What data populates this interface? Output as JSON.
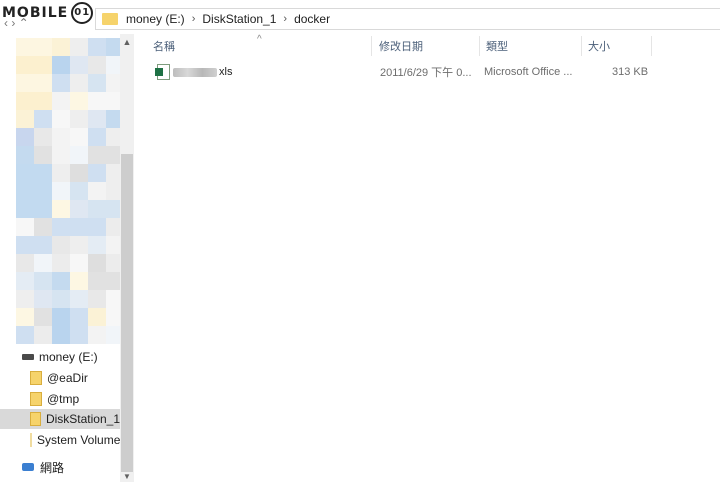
{
  "watermark": {
    "text": "MOBILE",
    "badge": "01"
  },
  "nav_arrows": "‹   ›   ⌃",
  "address": {
    "crumbs": [
      "money (E:)",
      "DiskStation_1",
      "docker"
    ],
    "separator": "›"
  },
  "sidebar": {
    "scroll_up": "▲",
    "scroll_down": "▼",
    "items": [
      {
        "label": "money (E:)",
        "icon": "drive-icon"
      },
      {
        "label": "@eaDir",
        "icon": "folder-icon"
      },
      {
        "label": "@tmp",
        "icon": "folder-icon"
      },
      {
        "label": "DiskStation_1",
        "icon": "folder-icon",
        "selected": true
      },
      {
        "label": "System Volume",
        "icon": "folder-icon"
      },
      {
        "label": "網路",
        "icon": "network-icon"
      }
    ]
  },
  "columns": {
    "name": "名稱",
    "modified": "修改日期",
    "type": "類型",
    "size": "大小",
    "sort_indicator": "^"
  },
  "files": [
    {
      "name_suffix": "xls",
      "modified": "2011/6/29 下午 0...",
      "type": "Microsoft Office ...",
      "size": "313 KB",
      "icon": "excel-file-icon"
    }
  ]
}
